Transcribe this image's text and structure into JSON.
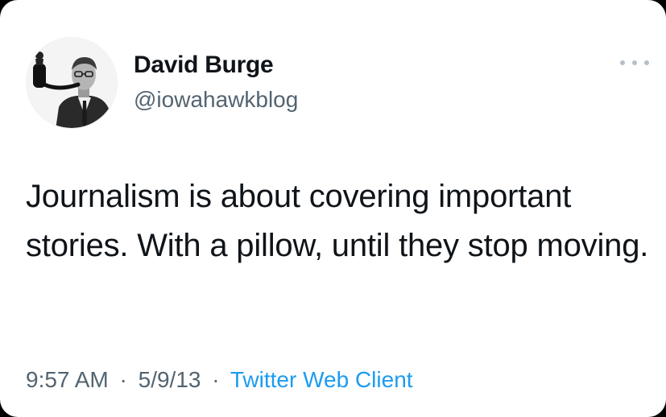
{
  "author": {
    "display_name": "David Burge",
    "handle": "@iowahawkblog",
    "avatar": "avatar-photo-man-with-pipe"
  },
  "tweet": {
    "text": "Journalism is about covering important stories. With a pillow, until they stop moving."
  },
  "meta": {
    "time": "9:57 AM",
    "separator": "·",
    "date": "5/9/13",
    "client": "Twitter Web Client"
  },
  "icons": {
    "more": "more-options-icon"
  },
  "colors": {
    "text": "#0f1419",
    "secondary": "#536471",
    "link": "#1d9bf0",
    "background": "#ffffff"
  }
}
